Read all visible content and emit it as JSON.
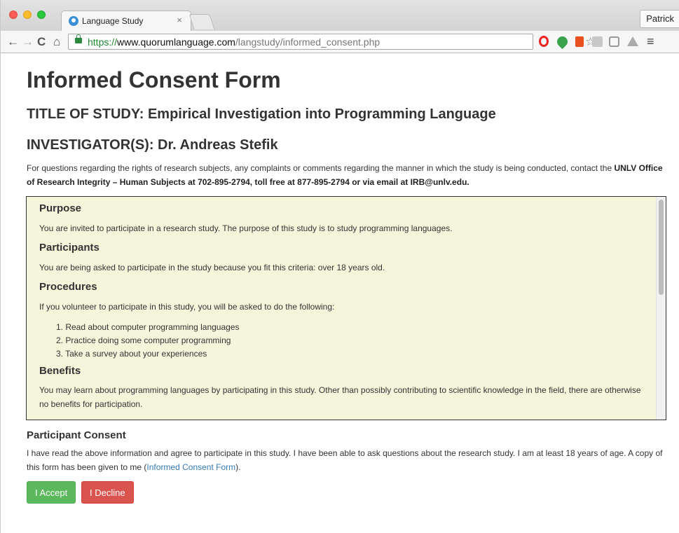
{
  "browser": {
    "tab_title": "Language Study",
    "tab_close": "×",
    "profile": "Patrick",
    "url_scheme": "https://",
    "url_host": "www.quorumlanguage.com",
    "url_path": "/langstudy/informed_consent.php",
    "icons": [
      "back-icon",
      "forward-icon",
      "reload-icon",
      "home-icon",
      "lock-icon",
      "star-icon",
      "opera-icon",
      "evernote-icon",
      "office-icon",
      "doc-icon",
      "cube-icon",
      "drive-icon",
      "menu-icon"
    ]
  },
  "page": {
    "title": "Informed Consent Form",
    "study_title": "TITLE OF STUDY: Empirical Investigation into Programming Language",
    "investigators": "INVESTIGATOR(S): Dr. Andreas Stefik",
    "contact_prefix": "For questions regarding the rights of research subjects, any complaints or comments regarding the manner in which the study is being conducted, contact the ",
    "contact_bold": "UNLV Office of Research Integrity – Human Subjects at 702-895-2794, toll free at 877-895-2794 or via email at IRB@unlv.edu."
  },
  "info": {
    "purpose_heading": "Purpose",
    "purpose_text": "You are invited to participate in a research study. The purpose of this study is to study programming languages.",
    "participants_heading": "Participants",
    "participants_text": "You are being asked to participate in the study because you fit this criteria: over 18 years old.",
    "procedures_heading": "Procedures",
    "procedures_text": "If you volunteer to participate in this study, you will be asked to do the following:",
    "procedures_steps": [
      "1. Read about computer programming languages",
      "2. Practice doing some computer programming",
      "3. Take a survey about your experiences"
    ],
    "benefits_heading": "Benefits",
    "benefits_text": "You may learn about programming languages by participating in this study. Other than possibly contributing to scientific knowledge in the field, there are otherwise no benefits for participation."
  },
  "consent": {
    "heading": "Participant Consent",
    "text_before": "I have read the above information and agree to participate in this study. I have been able to ask questions about the research study. I am at least 18 years of age. A copy of this form has been given to me (",
    "link": "Informed Consent Form",
    "text_after": ").",
    "accept_label": "I Accept",
    "decline_label": "I Decline"
  },
  "colors": {
    "accept": "#5cb85c",
    "decline": "#d9534f",
    "infobox_bg": "#f5f5dc",
    "link": "#337ab7",
    "secure": "#1d8a2e"
  }
}
